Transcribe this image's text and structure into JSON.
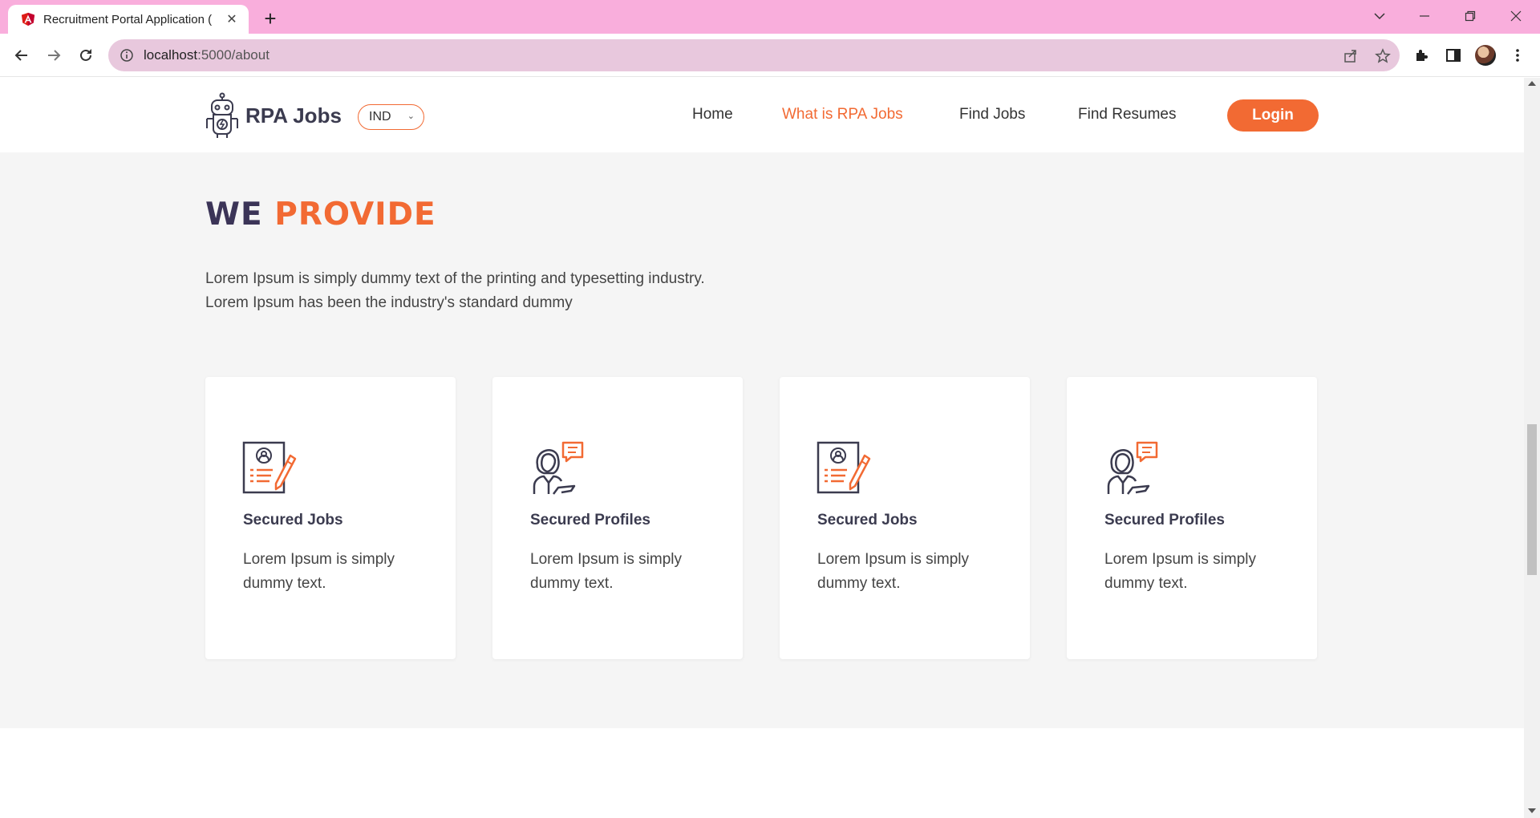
{
  "browser": {
    "tab_title": "Recruitment Portal Application (",
    "tab_favicon": "angular-icon",
    "url_host": "localhost",
    "url_path": ":5000/about"
  },
  "site": {
    "logo_text": "RPA Jobs",
    "country": "IND",
    "nav": [
      {
        "label": "Home",
        "active": false
      },
      {
        "label": "What is RPA Jobs",
        "active": true
      },
      {
        "label": "Find Jobs",
        "active": false
      },
      {
        "label": "Find Resumes",
        "active": false
      }
    ],
    "login_label": "Login",
    "accent_color": "#f26a33",
    "heading_dark_color": "#3b3457"
  },
  "section": {
    "heading_part1": "WE",
    "heading_part2": "PROVIDE",
    "intro": "Lorem Ipsum is simply dummy text of the printing and typesetting industry. Lorem Ipsum has been the industry's standard dummy",
    "cards": [
      {
        "icon": "resume-edit-icon",
        "title": "Secured Jobs",
        "text": "Lorem Ipsum is simply dummy text."
      },
      {
        "icon": "person-chat-icon",
        "title": "Secured Profiles",
        "text": "Lorem Ipsum is simply dummy text."
      },
      {
        "icon": "resume-edit-icon",
        "title": "Secured Jobs",
        "text": "Lorem Ipsum is simply dummy text."
      },
      {
        "icon": "person-chat-icon",
        "title": "Secured Profiles",
        "text": "Lorem Ipsum is simply dummy text."
      }
    ]
  }
}
